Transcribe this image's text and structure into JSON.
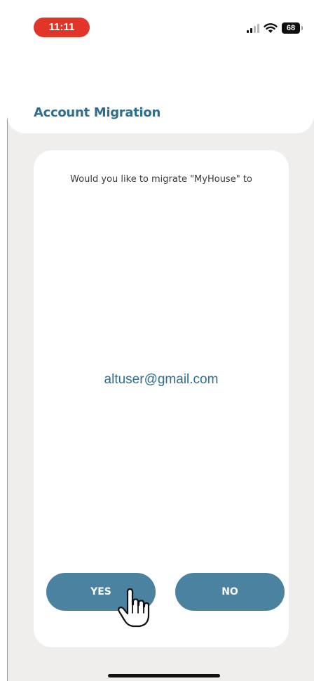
{
  "status_bar": {
    "time": "11:11",
    "battery": "68",
    "icons": [
      "signal-icon",
      "wifi-icon",
      "battery-icon"
    ],
    "time_badge_color": "#e2352a"
  },
  "header": {
    "title": "Account Migration"
  },
  "dialog": {
    "prompt": "Would you like to migrate \"MyHouse\" to",
    "email": "altuser@gmail.com",
    "yes_label": "YES",
    "no_label": "NO"
  },
  "colors": {
    "accent": "#2f6e8f",
    "button": "#4b82a0",
    "background": "#efeeec"
  },
  "cursor": {
    "icon": "hand-pointer-icon"
  }
}
